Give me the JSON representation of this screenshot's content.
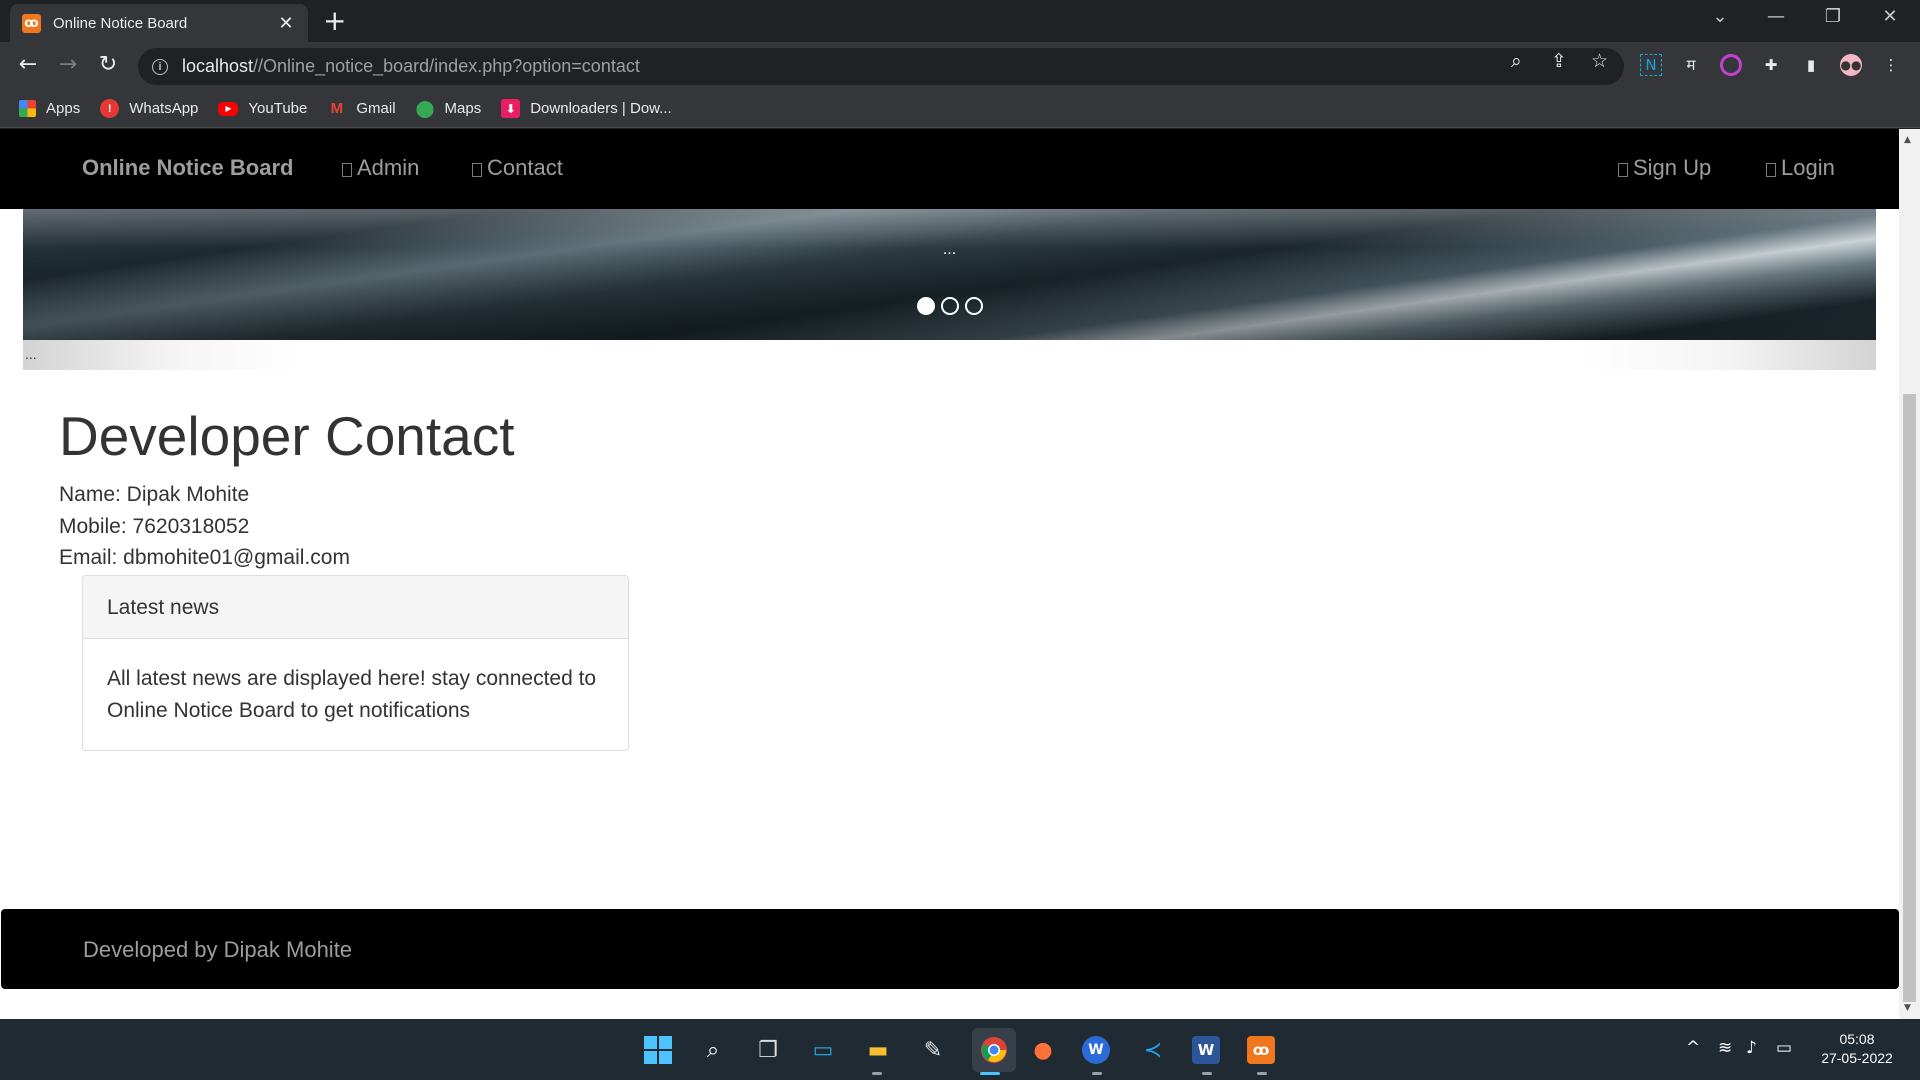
{
  "browser": {
    "tab_title": "Online Notice Board",
    "tab_icon": "xampp-icon",
    "new_tab": "+",
    "url_host": "localhost",
    "url_path": "//Online_notice_board/index.php?option=contact",
    "bookmarks": [
      {
        "label": "Apps",
        "icon": "apps-grid-icon"
      },
      {
        "label": "WhatsApp",
        "icon": "whatsapp-icon"
      },
      {
        "label": "YouTube",
        "icon": "youtube-icon"
      },
      {
        "label": "Gmail",
        "icon": "gmail-icon"
      },
      {
        "label": "Maps",
        "icon": "maps-icon"
      },
      {
        "label": "Downloaders | Dow...",
        "icon": "download-icon"
      }
    ]
  },
  "site": {
    "brand": "Online Notice Board",
    "nav_left": [
      {
        "label": "Admin"
      },
      {
        "label": "Contact"
      }
    ],
    "nav_right": [
      {
        "label": "Sign Up"
      },
      {
        "label": "Login"
      }
    ],
    "carousel": {
      "caption": "...",
      "slides": 3,
      "active_slide": 1
    },
    "marquee_text": "...",
    "heading": "Developer Contact",
    "contact": {
      "name": "Name: Dipak Mohite",
      "mobile": "Mobile: 7620318052",
      "email": "Email: dbmohite01@gmail.com"
    },
    "news_panel": {
      "title": "Latest news",
      "body": "All latest news are displayed here! stay connected to Online Notice Board to get notifications"
    },
    "footer": "Developed by Dipak Mohite"
  },
  "taskbar": {
    "apps": [
      "windows-start-icon",
      "search-icon",
      "task-view-icon",
      "desktop-icon",
      "file-explorer-icon",
      "notepad-icon",
      "chrome-icon",
      "firefox-icon",
      "wordpad-icon",
      "vscode-icon",
      "word-icon",
      "xampp-icon"
    ],
    "time": "05:08",
    "date": "27-05-2022"
  },
  "colors": {
    "navbar_bg": "#000000",
    "nav_text": "#9d9d9d",
    "chrome_dark": "#202124",
    "chrome_toolbar": "#35363a",
    "taskbar_bg": "#1f2a33",
    "xampp_orange": "#f0771e"
  }
}
